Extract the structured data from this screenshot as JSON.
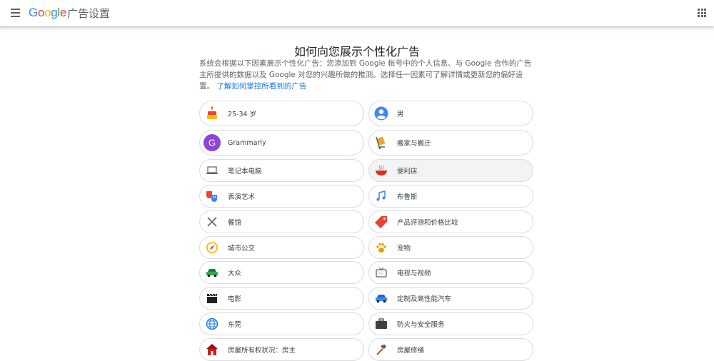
{
  "header": {
    "logo_letters": [
      {
        "char": "G",
        "color": "#4285F4"
      },
      {
        "char": "o",
        "color": "#EA4335"
      },
      {
        "char": "o",
        "color": "#FBBC05"
      },
      {
        "char": "g",
        "color": "#4285F4"
      },
      {
        "char": "l",
        "color": "#34A853"
      },
      {
        "char": "e",
        "color": "#EA4335"
      }
    ],
    "title": "广告设置",
    "menu_icon": "menu-icon",
    "apps_icon": "apps-grid-icon"
  },
  "main": {
    "heading": "如何向您展示个性化广告",
    "description": "系统会根据以下因素展示个性化广告：您添加到 Google 帐号中的个人信息、与 Google 合作的广告主所提供的数据以及 Google 对您的兴趣所做的推测。选择任一因素可了解详情或更新您的偏好设置。",
    "learn_more_link": "了解如何掌控所看到的广告",
    "factors": [
      {
        "label": "25-34 岁",
        "icon": "birthday-cake-icon"
      },
      {
        "label": "男",
        "icon": "person-icon"
      },
      {
        "label": "Grammarly",
        "icon": "grammarly-g-icon"
      },
      {
        "label": "搬家与搬迁",
        "icon": "moving-cart-icon"
      },
      {
        "label": "笔记本电脑",
        "icon": "laptop-icon"
      },
      {
        "label": "便利店",
        "icon": "noodle-bowl-icon"
      },
      {
        "label": "表演艺术",
        "icon": "theater-masks-icon"
      },
      {
        "label": "布鲁斯",
        "icon": "music-note-icon"
      },
      {
        "label": "餐馆",
        "icon": "fork-knife-icon"
      },
      {
        "label": "产品评测和价格比较",
        "icon": "price-tag-icon"
      },
      {
        "label": "城市公交",
        "icon": "compass-icon"
      },
      {
        "label": "宠物",
        "icon": "paw-icon"
      },
      {
        "label": "大众",
        "icon": "car-icon"
      },
      {
        "label": "电视与视频",
        "icon": "tv-icon"
      },
      {
        "label": "电影",
        "icon": "clapperboard-icon"
      },
      {
        "label": "定制及高性能汽车",
        "icon": "sports-car-icon"
      },
      {
        "label": "东莞",
        "icon": "globe-icon"
      },
      {
        "label": "防火与安全服务",
        "icon": "briefcase-icon"
      },
      {
        "label": "房屋所有权状况：房主",
        "icon": "house-icon"
      },
      {
        "label": "房屋修缮",
        "icon": "hammer-icon"
      }
    ]
  },
  "colors": {
    "link": "#1a73e8",
    "border": "#dadce0",
    "hover_background": "#f1f3f4"
  }
}
